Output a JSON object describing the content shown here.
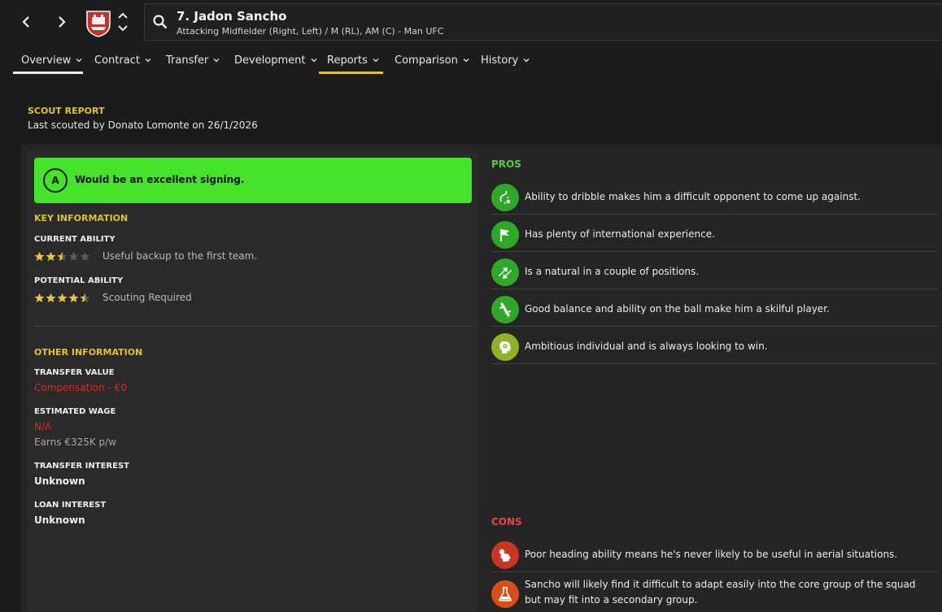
{
  "header": {
    "player_name": "7. Jadon Sancho",
    "player_sub": "Attacking Midfielder (Right, Left) / M (RL), AM (C) - Man UFC"
  },
  "tabs": [
    {
      "label": "Overview"
    },
    {
      "label": "Contract"
    },
    {
      "label": "Transfer"
    },
    {
      "label": "Development"
    },
    {
      "label": "Reports"
    },
    {
      "label": "Comparison"
    },
    {
      "label": "History"
    }
  ],
  "report": {
    "title": "SCOUT REPORT",
    "subtitle": "Last scouted by Donato Lomonte on 26/1/2026"
  },
  "verdict": {
    "grade": "A",
    "text": "Would be an excellent signing.",
    "color": "#47e22a"
  },
  "key_info": {
    "title": "KEY INFORMATION",
    "current_ability": {
      "label": "CURRENT ABILITY",
      "stars": 2.5,
      "note": "Useful backup to the first team."
    },
    "potential_ability": {
      "label": "POTENTIAL ABILITY",
      "stars": 4.5,
      "note": "Scouting Required"
    }
  },
  "other_info": {
    "title": "OTHER INFORMATION",
    "transfer_value": {
      "label": "TRANSFER VALUE",
      "value": "Compensation - €0"
    },
    "estimated_wage": {
      "label": "ESTIMATED WAGE",
      "value": "N/A",
      "earns": "Earns €325K p/w"
    },
    "transfer_interest": {
      "label": "TRANSFER INTEREST",
      "value": "Unknown"
    },
    "loan_interest": {
      "label": "LOAN INTEREST",
      "value": "Unknown"
    }
  },
  "pros": {
    "title": "PROS",
    "items": [
      {
        "icon": "dribble-icon",
        "text": "Ability to dribble makes him a difficult opponent to come up against."
      },
      {
        "icon": "flag-icon",
        "text": "Has plenty of international experience."
      },
      {
        "icon": "position-arrows-icon",
        "text": "Is a natural in a couple of positions."
      },
      {
        "icon": "balance-icon",
        "text": "Good balance and ability on the ball make him a skilful player."
      },
      {
        "icon": "ambition-head-icon",
        "text": "Ambitious individual and is always looking to win."
      }
    ]
  },
  "cons": {
    "title": "CONS",
    "items": [
      {
        "icon": "heading-icon",
        "text": "Poor heading ability means he's never likely to be useful in aerial situations."
      },
      {
        "icon": "flask-icon",
        "text": "Sancho will likely find it difficult to adapt easily into the core group of the squad but may fit into a secondary group."
      }
    ]
  },
  "colors": {
    "accent_yellow": "#e0c233",
    "pros_green": "#4fd23d",
    "cons_red": "#e24a4a",
    "value_red": "#d82a2a",
    "club_red": "#c8302c"
  }
}
